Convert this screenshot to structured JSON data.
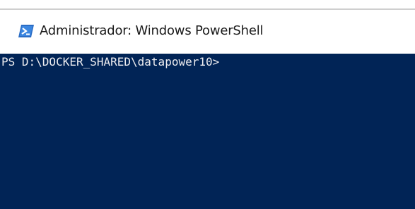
{
  "window": {
    "title": "Administrador: Windows PowerShell",
    "icon": "powershell-icon"
  },
  "console": {
    "prompt": "PS D:\\DOCKER_SHARED\\datapower10>",
    "background_color": "#012456",
    "text_color": "#eeedf0"
  }
}
